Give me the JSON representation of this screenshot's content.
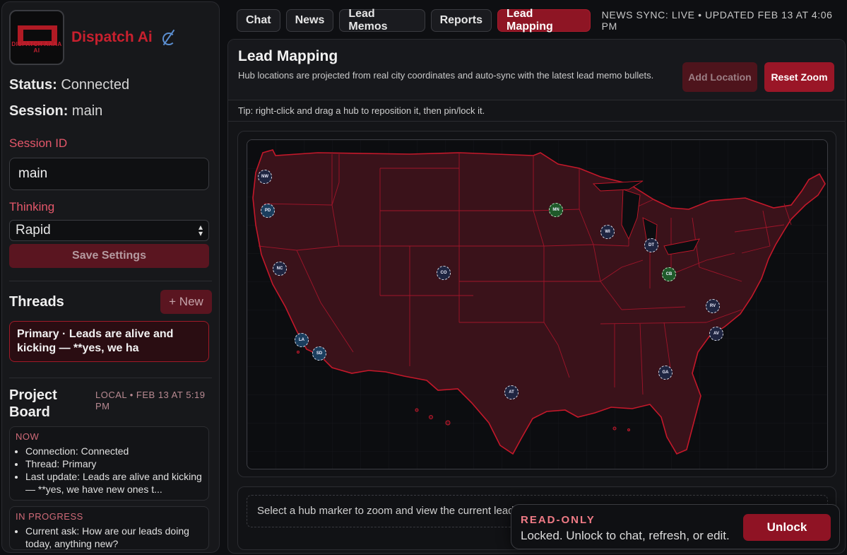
{
  "brand": {
    "name": "Dispatch Ai",
    "logo_text": "DISPATCH AAAA AI",
    "icon": "edit-icon"
  },
  "status": {
    "label": "Status:",
    "value": "Connected"
  },
  "session": {
    "label": "Session:",
    "value": "main"
  },
  "session_id": {
    "label": "Session ID",
    "value": "main"
  },
  "thinking": {
    "label": "Thinking",
    "value": "Rapid"
  },
  "save_label": "Save Settings",
  "threads": {
    "title": "Threads",
    "new_label": "+ New",
    "items": [
      {
        "label": "Primary · Leads are alive and kicking — **yes, we ha"
      }
    ]
  },
  "project_board": {
    "title": "Project Board",
    "meta": "LOCAL • FEB 13 AT 5:19 PM",
    "now": {
      "title": "NOW",
      "items": [
        "Connection: Connected",
        "Thread: Primary",
        "Last update: Leads are alive and kicking — **yes, we have new ones t..."
      ]
    },
    "in_progress": {
      "title": "IN PROGRESS",
      "items": [
        "Current ask: How are our leads doing today, anything new?"
      ]
    }
  },
  "tabs": [
    "Chat",
    "News",
    "Lead Memos",
    "Reports",
    "Lead Mapping"
  ],
  "active_tab": "Lead Mapping",
  "sync_status": "NEWS SYNC: LIVE • UPDATED FEB 13 AT 4:06 PM",
  "page": {
    "title": "Lead Mapping",
    "description": "Hub locations are projected from real city coordinates and auto-sync with the latest lead memo bullets.",
    "add_label": "Add Location",
    "reset_label": "Reset Zoom",
    "tip": "Tip: right-click and drag a hub to reposition it, then pin/lock it."
  },
  "hubs": [
    {
      "code": "NW",
      "state": "default"
    },
    {
      "code": "PD",
      "state": "blue"
    },
    {
      "code": "NC",
      "state": "default"
    },
    {
      "code": "CO",
      "state": "default"
    },
    {
      "code": "LA",
      "state": "blue"
    },
    {
      "code": "SD",
      "state": "blue"
    },
    {
      "code": "MN",
      "state": "green"
    },
    {
      "code": "WI",
      "state": "default"
    },
    {
      "code": "DT",
      "state": "default"
    },
    {
      "code": "CB",
      "state": "green"
    },
    {
      "code": "RV",
      "state": "default"
    },
    {
      "code": "AV",
      "state": "default"
    },
    {
      "code": "GA",
      "state": "default"
    },
    {
      "code": "AT",
      "state": "default"
    }
  ],
  "detail_prompt": "Select a hub marker to zoom and view the current lead l",
  "readonly": {
    "title": "READ-ONLY",
    "message": "Locked. Unlock to chat, refresh, or edit.",
    "unlock_label": "Unlock"
  },
  "colors": {
    "accent": "#8e1524",
    "map_fill": "#3a121a",
    "map_stroke": "#c4182a"
  }
}
